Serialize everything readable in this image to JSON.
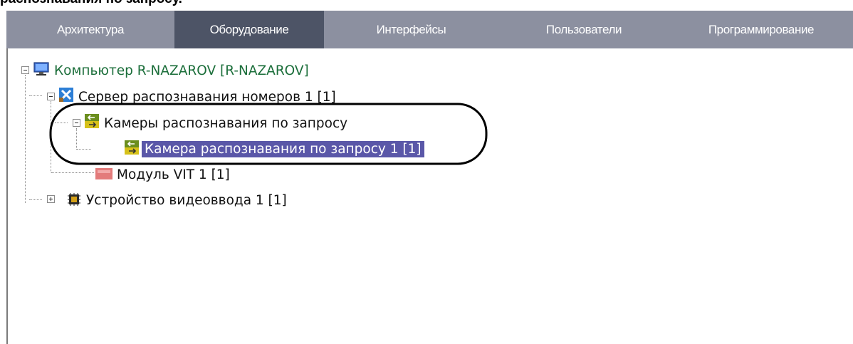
{
  "caption": "распознавания по запросу.",
  "tabs": [
    {
      "label": "Архитектура",
      "active": false
    },
    {
      "label": "Оборудование",
      "active": true
    },
    {
      "label": "Интерфейсы",
      "active": false
    },
    {
      "label": "Пользователи",
      "active": false
    },
    {
      "label": "Программирование",
      "active": false
    }
  ],
  "tree": {
    "computer": "Компьютер R-NAZAROV [R-NAZAROV]",
    "lpr_server": "Сервер распознавания номеров 1 [1]",
    "cameras_group": "Камеры распознавания по запросу",
    "camera": "Камера распознавания по запросу 1 [1]",
    "vit_module": "Модуль VIT 1 [1]",
    "video_device": "Устройство видеоввода 1 [1]"
  },
  "colors": {
    "tabbar": "#8c90a0",
    "active_tab": "#4d5466",
    "selection": "#5a57a8",
    "computer_text": "#1b6e3a",
    "annotation": "#000000"
  }
}
